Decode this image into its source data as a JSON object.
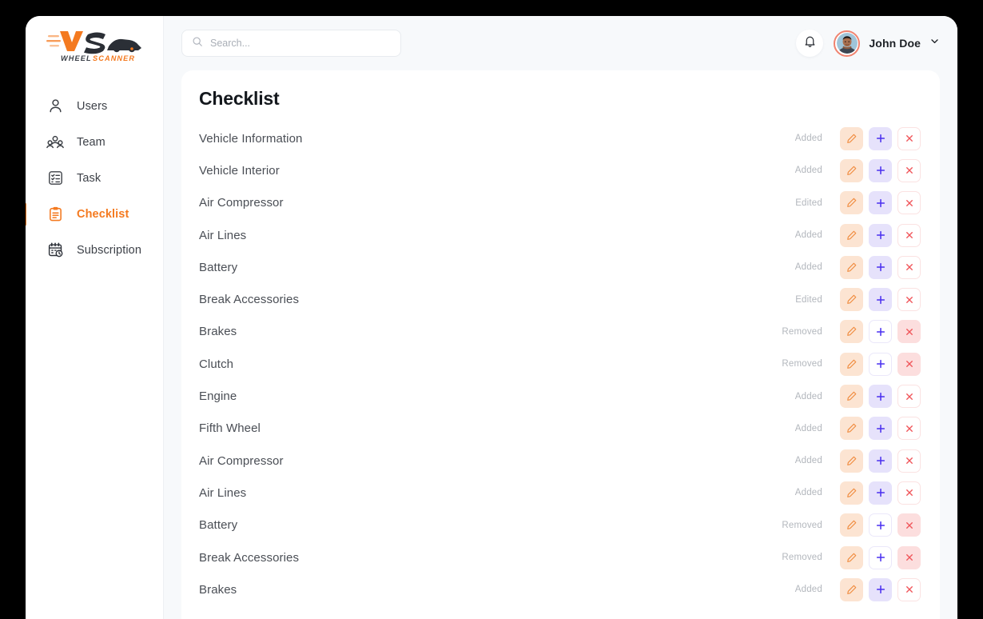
{
  "brand": {
    "mark": "WS",
    "name": "WHEEL SCANNER",
    "accent": "#f47a20"
  },
  "sidebar": {
    "items": [
      {
        "label": "Users",
        "icon": "user-icon",
        "active": false
      },
      {
        "label": "Team",
        "icon": "team-icon",
        "active": false
      },
      {
        "label": "Task",
        "icon": "task-list-icon",
        "active": false
      },
      {
        "label": "Checklist",
        "icon": "clipboard-icon",
        "active": true
      },
      {
        "label": "Subscription",
        "icon": "calendar-clock-icon",
        "active": false
      }
    ]
  },
  "topbar": {
    "search": {
      "value": "",
      "placeholder": "Search..."
    },
    "notifications_icon": "bell-icon",
    "user": {
      "name": "John Doe",
      "avatar": "user-avatar",
      "caret": "chevron-down-icon"
    }
  },
  "main": {
    "title": "Checklist",
    "actions": {
      "edit_label": "Edit",
      "add_label": "Add",
      "delete_label": "Delete"
    },
    "rows": [
      {
        "name": "Vehicle Information",
        "status": "Added"
      },
      {
        "name": "Vehicle Interior",
        "status": "Added"
      },
      {
        "name": "Air Compressor",
        "status": "Edited"
      },
      {
        "name": "Air Lines",
        "status": "Added"
      },
      {
        "name": "Battery",
        "status": "Added"
      },
      {
        "name": "Break Accessories",
        "status": "Edited"
      },
      {
        "name": "Brakes",
        "status": "Removed"
      },
      {
        "name": "Clutch",
        "status": "Removed"
      },
      {
        "name": "Engine",
        "status": "Added"
      },
      {
        "name": "Fifth Wheel",
        "status": "Added"
      },
      {
        "name": "Air Compressor",
        "status": "Added"
      },
      {
        "name": "Air Lines",
        "status": "Added"
      },
      {
        "name": "Battery",
        "status": "Removed"
      },
      {
        "name": "Break Accessories",
        "status": "Removed"
      },
      {
        "name": "Brakes",
        "status": "Added"
      }
    ]
  },
  "colors": {
    "accent": "#f47a20",
    "edit_bg": "#fce4d2",
    "edit_fg": "#f08a3c",
    "add_bg": "#e6e2fb",
    "add_fg": "#4a30f0",
    "delete_fg": "#f0555a",
    "delete_bg_active": "#fcdede",
    "avatar_ring": "#f0836f",
    "page_bg": "#f7f9fb"
  }
}
